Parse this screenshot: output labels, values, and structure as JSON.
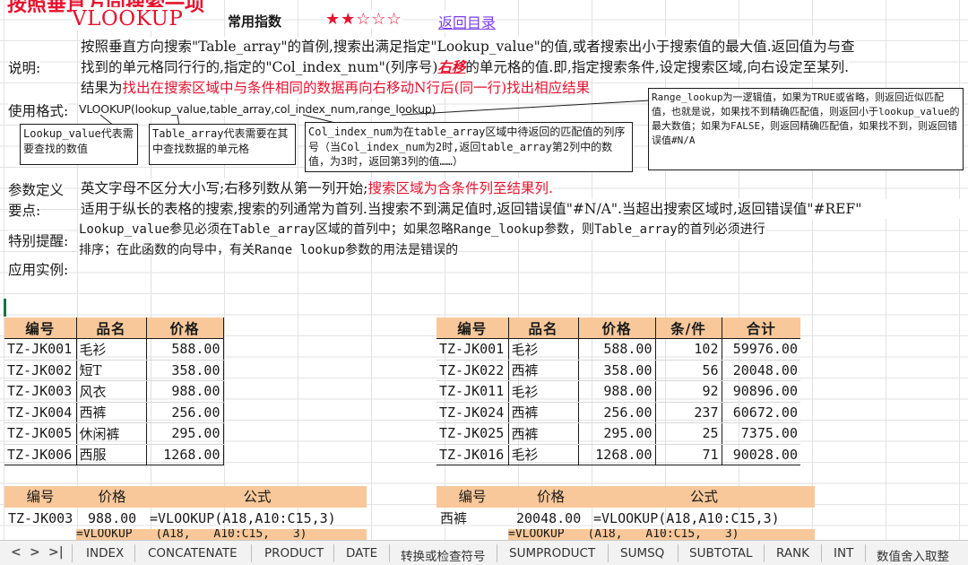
{
  "header": {
    "cut_title": "按照垂直方向搜索一项",
    "function_name": "VLOOKUP",
    "frequency_label": "常用指数",
    "stars": "★★☆☆☆",
    "back_link": "返回目录"
  },
  "labels": {
    "description": "说明:",
    "syntax": "使用格式:",
    "params": "参数定义",
    "key_points": "要点:",
    "notice": "特别提醒:",
    "examples": "应用实例:"
  },
  "description": {
    "line1": "按照垂直方向搜索\"Table_array\"的首例,搜索出满足指定\"Lookup_value\"的值,或者搜索出小于搜索值的最大值.返回值为与查",
    "line2_a": "找到的单元格同行行的,指定的\"Col_index_num\"(列序号)",
    "line2_b": "右移",
    "line2_c": "的单元格的值.即,指定搜索条件,设定搜索区域,向右设定至某列.",
    "line3_a": "结果为",
    "line3_b": "找出在搜索区域中与条件相同的数据再向右移动N行后(同一行)找出相应结果"
  },
  "syntax": {
    "formula": "VLOOKUP(lookup_value,table_array,col_index_num,range_lookup)"
  },
  "callouts": {
    "lookup_value": "Lookup_value代表需要查找的数值",
    "table_array": "Table_array代表需要在其中查找数据的单元格",
    "col_index_num": "Col_index_num为在table_array区域中待返回的匹配值的列序号（当Col_index_num为2时,返回table_array第2列中的数值，为3时，返回第3列的值……）",
    "range_lookup": "Range_lookup为一逻辑值，如果为TRUE或省略，则返回近似匹配值，也就是说，如果找不到精确匹配值，则返回小于lookup_value的最大数值；如果为FALSE，则返回精确匹配值，如果找不到，则返回错误值#N/A"
  },
  "params": {
    "text_a": "英文字母不区分大小写;右移列数从第一列开始;",
    "text_b": "搜索区域为含条件列至结果列."
  },
  "key_points": {
    "text": "适用于纵长的表格的搜索,搜索的列通常为首列.当搜索不到满足值时,返回错误值\"#N/A\".当超出搜索区域时,返回错误值\"#REF\""
  },
  "notice": {
    "line1": "Lookup_value参见必须在Table_array区域的首列中；如果忽略Range_lookup参数，则Table_array的首列必须进行",
    "line2": "排序；在此函数的向导中，有关Range_lookup参数的用法是错误的"
  },
  "table_left": {
    "headers": [
      "编号",
      "品名",
      "价格"
    ],
    "rows": [
      [
        "TZ-JK001",
        "毛衫",
        "588.00"
      ],
      [
        "TZ-JK002",
        "短T",
        "358.00"
      ],
      [
        "TZ-JK003",
        "风衣",
        "988.00"
      ],
      [
        "TZ-JK004",
        "西裤",
        "256.00"
      ],
      [
        "TZ-JK005",
        "休闲裤",
        "295.00"
      ],
      [
        "TZ-JK006",
        "西服",
        "1268.00"
      ]
    ]
  },
  "table_right": {
    "headers": [
      "编号",
      "品名",
      "价格",
      "条/件",
      "合计"
    ],
    "rows": [
      [
        "TZ-JK001",
        "毛衫",
        "588.00",
        "102",
        "59976.00"
      ],
      [
        "TZ-JK022",
        "西裤",
        "358.00",
        "56",
        "20048.00"
      ],
      [
        "TZ-JK011",
        "毛衫",
        "988.00",
        "92",
        "90896.00"
      ],
      [
        "TZ-JK024",
        "西裤",
        "256.00",
        "237",
        "60672.00"
      ],
      [
        "TZ-JK025",
        "西裤",
        "295.00",
        "25",
        "7375.00"
      ],
      [
        "TZ-JK016",
        "毛衫",
        "1268.00",
        "71",
        "90028.00"
      ]
    ]
  },
  "formula_left": {
    "headers": [
      "编号",
      "价格",
      "公式"
    ],
    "key": "TZ-JK003",
    "value": "988.00",
    "formula": "=VLOOKUP(A18,A10:C15,3)",
    "formula_cut": "=VLOOKUP (A18, A10:C15, 3)"
  },
  "formula_right": {
    "headers": [
      "编号",
      "价格",
      "公式"
    ],
    "key": "西裤",
    "value": "20048.00",
    "formula": "=VLOOKUP(A18,A10:C15,3)",
    "formula_cut": "=VLOOKUP (A18, A10:C15, 3)"
  },
  "sheet_tabs": {
    "nav": [
      "<",
      ">",
      ">|"
    ],
    "tabs": [
      "INDEX",
      "CONCATENATE",
      "PRODUCT",
      "DATE",
      "转换或检查符号",
      "SUMPRODUCT",
      "SUMSQ",
      "SUBTOTAL",
      "RANK",
      "INT",
      "数值舍入取整"
    ]
  }
}
